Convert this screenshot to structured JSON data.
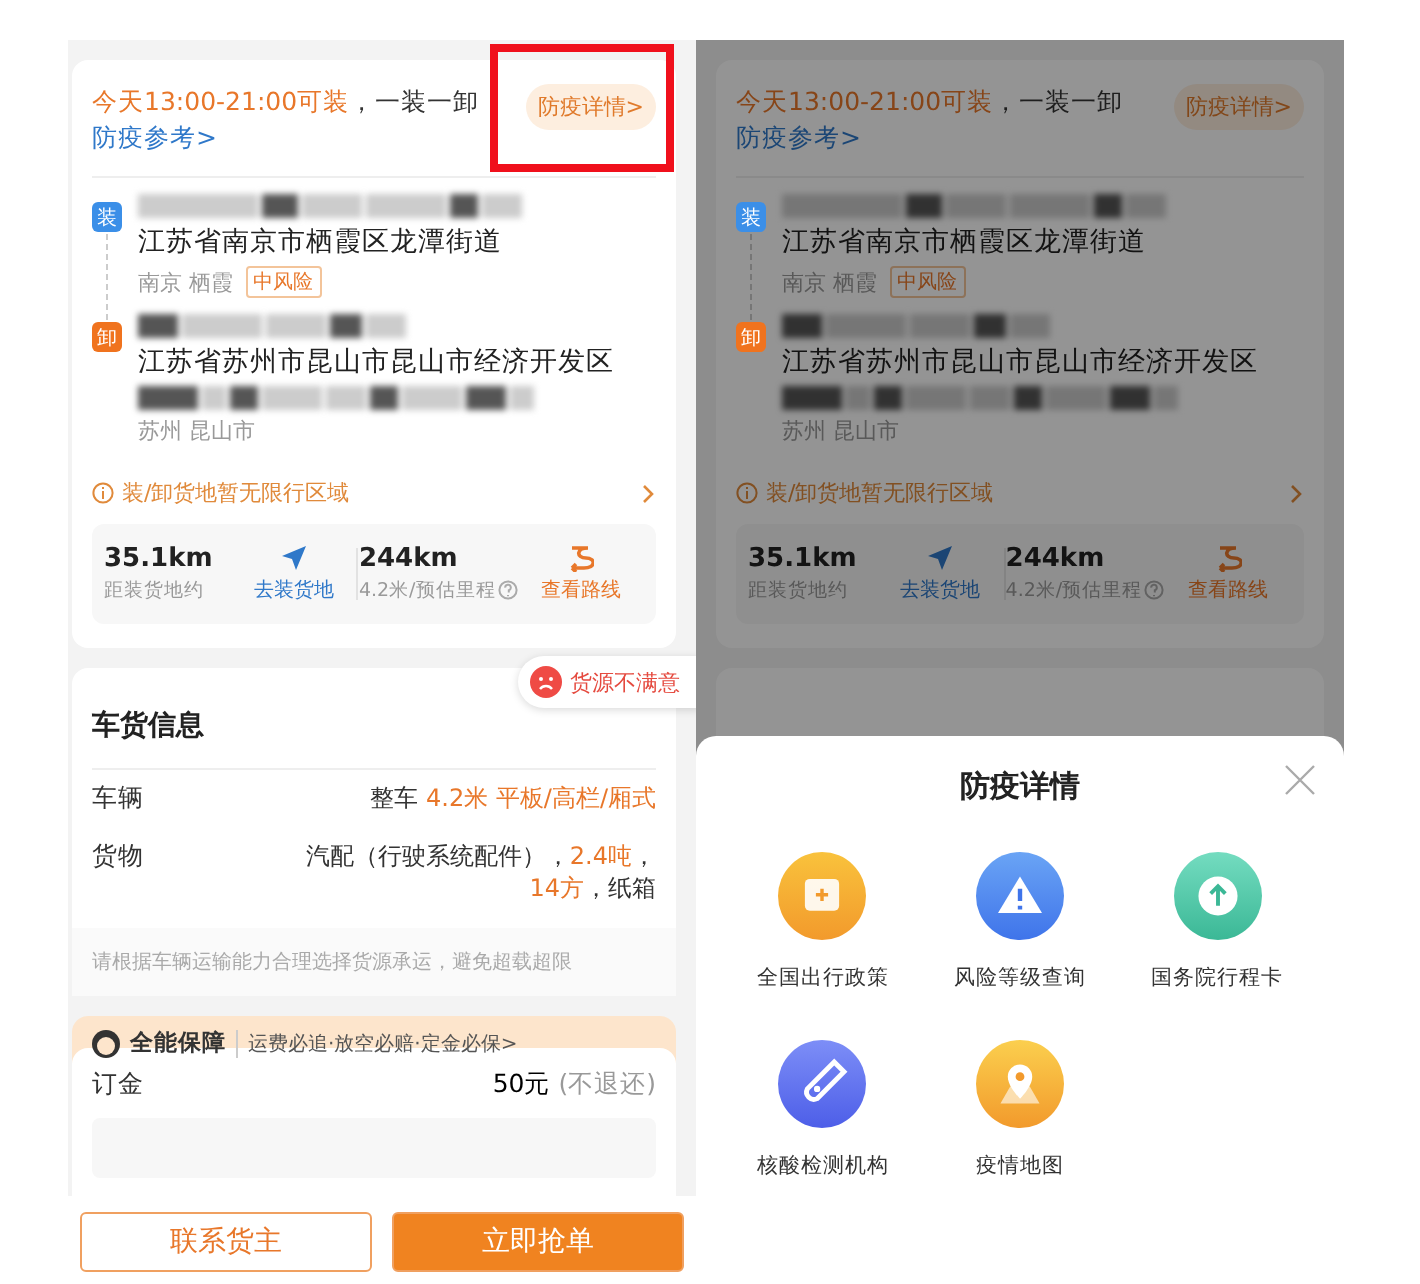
{
  "screens": [
    {
      "kind": "detail",
      "route_card": {
        "notice": [
          {
            "text": "今天13:00-21:00可装",
            "color": "#e8772a"
          },
          {
            "text": "，一装一卸 ",
            "color": "#333333"
          },
          {
            "text": "防疫参考>",
            "color": "#2f78c9"
          }
        ],
        "epidemic_button": {
          "label": "防疫详情>",
          "highlighted": true
        },
        "stops": [
          {
            "kind": "load",
            "badge": "装",
            "address": "江苏省南京市栖霞区龙潭街道",
            "area": "南京 栖霞",
            "risk": "中风险"
          },
          {
            "kind": "unload",
            "badge": "卸",
            "address": "江苏省苏州市昆山市昆山市经济开发区",
            "area": "苏州 昆山市"
          }
        ],
        "restriction": "装/卸货地暂无限行区域",
        "stats": [
          {
            "value": "35.1km",
            "caption": "距装货地约",
            "action": "去装货地",
            "kind": "navigate"
          },
          {
            "value": "244km",
            "caption": "4.2米/预估里程",
            "action": "查看路线",
            "kind": "route"
          }
        ]
      },
      "cargo_card": {
        "title": "车货信息",
        "feedback": "货源不满意",
        "rows": [
          {
            "label": "车辆",
            "value": [
              {
                "text": "整车 ",
                "color": "#333333"
              },
              {
                "text": "4.2米 平板/高栏/厢式",
                "color": "#e8772a"
              }
            ]
          },
          {
            "label": "货物",
            "value": [
              {
                "text": "汽配（行驶系统配件），",
                "color": "#333333"
              },
              {
                "text": "2.4吨",
                "color": "#e8772a"
              },
              {
                "text": "，",
                "color": "#333333"
              },
              {
                "text": "14方",
                "color": "#e8772a"
              },
              {
                "text": "，纸箱",
                "color": "#333333"
              }
            ]
          }
        ],
        "tip": "请根据车辆运输能力合理选择货源承运，避免超载超限"
      },
      "guarantee": {
        "title": "全能保障",
        "terms": "运费必追·放空必赔·定金必保>"
      },
      "deposit": {
        "label": "订金",
        "amount": "50元",
        "note": "(不退还)"
      },
      "actions": [
        {
          "label": "联系货主",
          "kind": "secondary"
        },
        {
          "label": "立即抢单",
          "kind": "primary"
        }
      ]
    },
    {
      "kind": "sheet",
      "route_card": {
        "notice": [
          {
            "text": "今天13:00-21:00可装",
            "color": "#874518"
          },
          {
            "text": "，一装一卸 ",
            "color": "#1e1e1e"
          },
          {
            "text": "防疫参考>",
            "color": "#1b4675"
          }
        ],
        "epidemic_button": {
          "label": "防疫详情>",
          "highlighted": false
        },
        "stops": [
          {
            "kind": "load",
            "badge": "装",
            "address": "江苏省南京市栖霞区龙潭街道",
            "area": "南京 栖霞",
            "risk": "中风险"
          },
          {
            "kind": "unload",
            "badge": "卸",
            "address": "江苏省苏州市昆山市昆山市经济开发区",
            "area": "苏州 昆山市"
          }
        ],
        "restriction": "装/卸货地暂无限行区域",
        "stats": [
          {
            "value": "35.1km",
            "caption": "距装货地约",
            "action": "去装货地",
            "kind": "navigate"
          },
          {
            "value": "244km",
            "caption": "4.2米/预估里程",
            "action": "查看路线",
            "kind": "route"
          }
        ]
      },
      "sheet": {
        "title": "防疫详情",
        "items": [
          {
            "label": "全国出行政策",
            "kind": "policy"
          },
          {
            "label": "风险等级查询",
            "kind": "risk"
          },
          {
            "label": "国务院行程卡",
            "kind": "trip"
          },
          {
            "label": "核酸检测机构",
            "kind": "test"
          },
          {
            "label": "疫情地图",
            "kind": "map"
          }
        ]
      }
    }
  ]
}
